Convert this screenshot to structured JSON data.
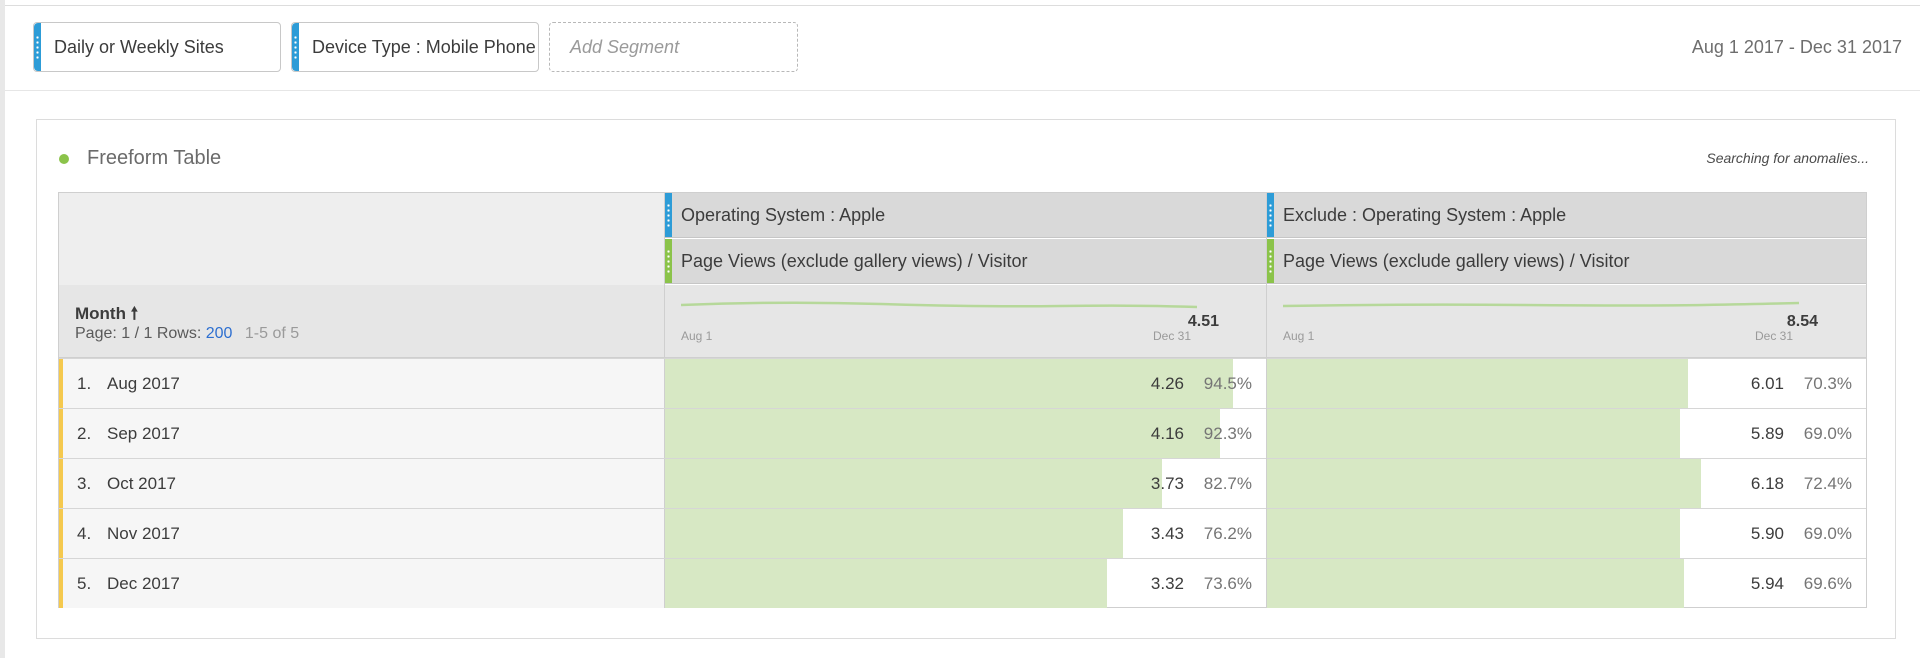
{
  "segments": [
    {
      "label": "Daily or Weekly Sites"
    },
    {
      "label": "Device Type : Mobile Phone"
    }
  ],
  "add_segment_placeholder": "Add Segment",
  "date_range": "Aug 1 2017 - Dec 31 2017",
  "panel": {
    "title": "Freeform Table",
    "status": "Searching for anomalies..."
  },
  "dimension": {
    "name": "Month",
    "sort_icon": "arrow-up-icon",
    "page_label": "Page: 1 / 1",
    "rows_label": "Rows:",
    "rows_value": "200",
    "range": "1-5 of 5"
  },
  "columns": [
    {
      "segment": "Operating System : Apple",
      "metric": "Page Views (exclude gallery views) / Visitor",
      "spark_start": "Aug 1",
      "spark_end": "Dec 31",
      "total": "4.51"
    },
    {
      "segment": "Exclude : Operating System : Apple",
      "metric": "Page Views (exclude gallery views) / Visitor",
      "spark_start": "Aug 1",
      "spark_end": "Dec 31",
      "total": "8.54"
    }
  ],
  "rows": [
    {
      "num": "1.",
      "name": "Aug 2017",
      "cells": [
        {
          "value": "4.26",
          "pct": "94.5%",
          "fill": 0.945
        },
        {
          "value": "6.01",
          "pct": "70.3%",
          "fill": 0.703
        }
      ]
    },
    {
      "num": "2.",
      "name": "Sep 2017",
      "cells": [
        {
          "value": "4.16",
          "pct": "92.3%",
          "fill": 0.923
        },
        {
          "value": "5.89",
          "pct": "69.0%",
          "fill": 0.69
        }
      ]
    },
    {
      "num": "3.",
      "name": "Oct 2017",
      "cells": [
        {
          "value": "3.73",
          "pct": "82.7%",
          "fill": 0.827
        },
        {
          "value": "6.18",
          "pct": "72.4%",
          "fill": 0.724
        }
      ]
    },
    {
      "num": "4.",
      "name": "Nov 2017",
      "cells": [
        {
          "value": "3.43",
          "pct": "76.2%",
          "fill": 0.762
        },
        {
          "value": "5.90",
          "pct": "69.0%",
          "fill": 0.69
        }
      ]
    },
    {
      "num": "5.",
      "name": "Dec 2017",
      "cells": [
        {
          "value": "3.32",
          "pct": "73.6%",
          "fill": 0.736
        },
        {
          "value": "5.94",
          "pct": "69.6%",
          "fill": 0.696
        }
      ]
    }
  ],
  "colors": {
    "segment_blue": "#2d9cd7",
    "metric_green": "#8bc34a",
    "bar_fill": "#d7e8c4",
    "row_stripe": "#f5c94e",
    "link_blue": "#2d6fd0"
  }
}
